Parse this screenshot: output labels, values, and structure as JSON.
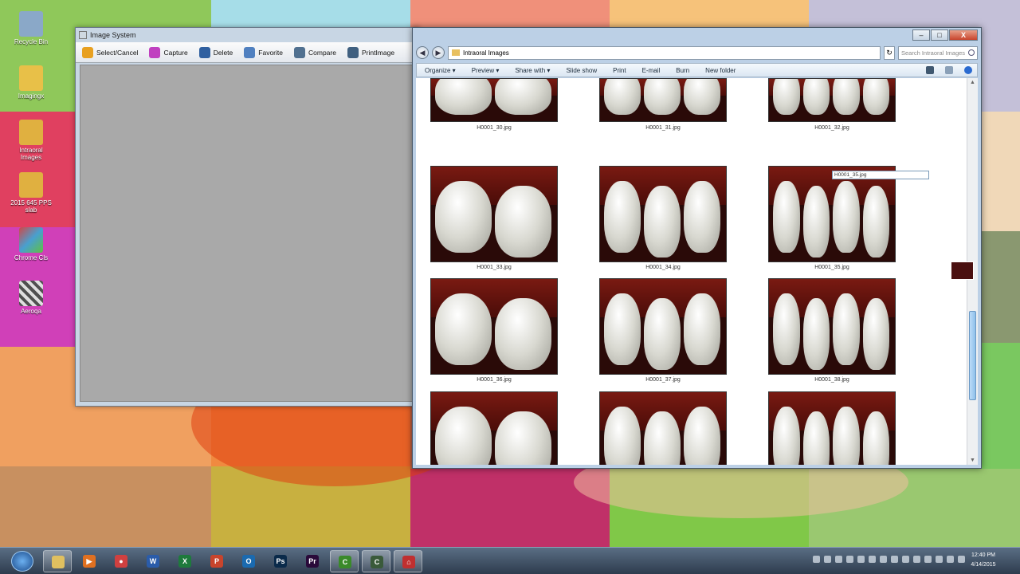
{
  "desktop": {
    "icons": [
      {
        "label": "Recycle Bin",
        "color": "#8aa8c8"
      },
      {
        "label": "Imagingx",
        "color": "#e8c048"
      },
      {
        "label": "Intraoral Images",
        "color": "#e0b040"
      },
      {
        "label": "2015 645 PPS slab",
        "color": "#e0b040"
      },
      {
        "label": "Chrome Cls",
        "color": "#d04848"
      },
      {
        "label": "Aeroqa",
        "color": "#606060"
      }
    ]
  },
  "image_system": {
    "title": "Image System",
    "toolbar": [
      {
        "label": "Select/Cancel",
        "color": "#e8a020"
      },
      {
        "label": "Capture",
        "color": "#c040c0"
      },
      {
        "label": "Delete",
        "color": "#3060a0"
      },
      {
        "label": "Favorite",
        "color": "#5080c0"
      },
      {
        "label": "Compare",
        "color": "#507090"
      },
      {
        "label": "PrintImage",
        "color": "#406080"
      }
    ]
  },
  "explorer": {
    "controls": {
      "minimize": "–",
      "maximize": "□",
      "close": "X"
    },
    "nav": {
      "back": "◀",
      "forward": "▶"
    },
    "address": "Intraoral Images",
    "refresh": "↻",
    "search_placeholder": "Search Intraoral Images",
    "commands": [
      "Organize ▾",
      "Preview ▾",
      "Share with ▾",
      "Slide show",
      "Print",
      "E-mail",
      "Burn",
      "New folder"
    ],
    "files": [
      "H0001_30.jpg",
      "H0001_31.jpg",
      "H0001_32.jpg",
      "H0001_33.jpg",
      "H0001_34.jpg",
      "H0001_35.jpg",
      "H0001_36.jpg",
      "H0001_37.jpg",
      "H0001_38.jpg",
      "",
      "",
      ""
    ],
    "rename_value": "H0001_35.jpg"
  },
  "taskbar": {
    "apps": [
      {
        "name": "explorer",
        "glyph": "",
        "color": "#e0c060",
        "active": true
      },
      {
        "name": "media-player",
        "glyph": "▶",
        "color": "#e07020",
        "active": false
      },
      {
        "name": "chrome",
        "glyph": "●",
        "color": "#d04040",
        "active": false
      },
      {
        "name": "word",
        "glyph": "W",
        "color": "#2a5caa",
        "active": false
      },
      {
        "name": "excel",
        "glyph": "X",
        "color": "#1e7a3c",
        "active": false
      },
      {
        "name": "powerpoint",
        "glyph": "P",
        "color": "#c8442c",
        "active": false
      },
      {
        "name": "outlook",
        "glyph": "O",
        "color": "#1a6ab0",
        "active": false
      },
      {
        "name": "photoshop",
        "glyph": "Ps",
        "color": "#0a2a4a",
        "active": false
      },
      {
        "name": "premiere",
        "glyph": "Pr",
        "color": "#2a0a3a",
        "active": false
      },
      {
        "name": "camtasia",
        "glyph": "C",
        "color": "#3a8a2a",
        "active": true
      },
      {
        "name": "camtasia-recorder",
        "glyph": "C",
        "color": "#3a5a3a",
        "active": true
      },
      {
        "name": "dental-app",
        "glyph": "⌂",
        "color": "#c03030",
        "active": true
      }
    ],
    "clock_time": "12:40 PM",
    "clock_date": "4/14/2015"
  }
}
